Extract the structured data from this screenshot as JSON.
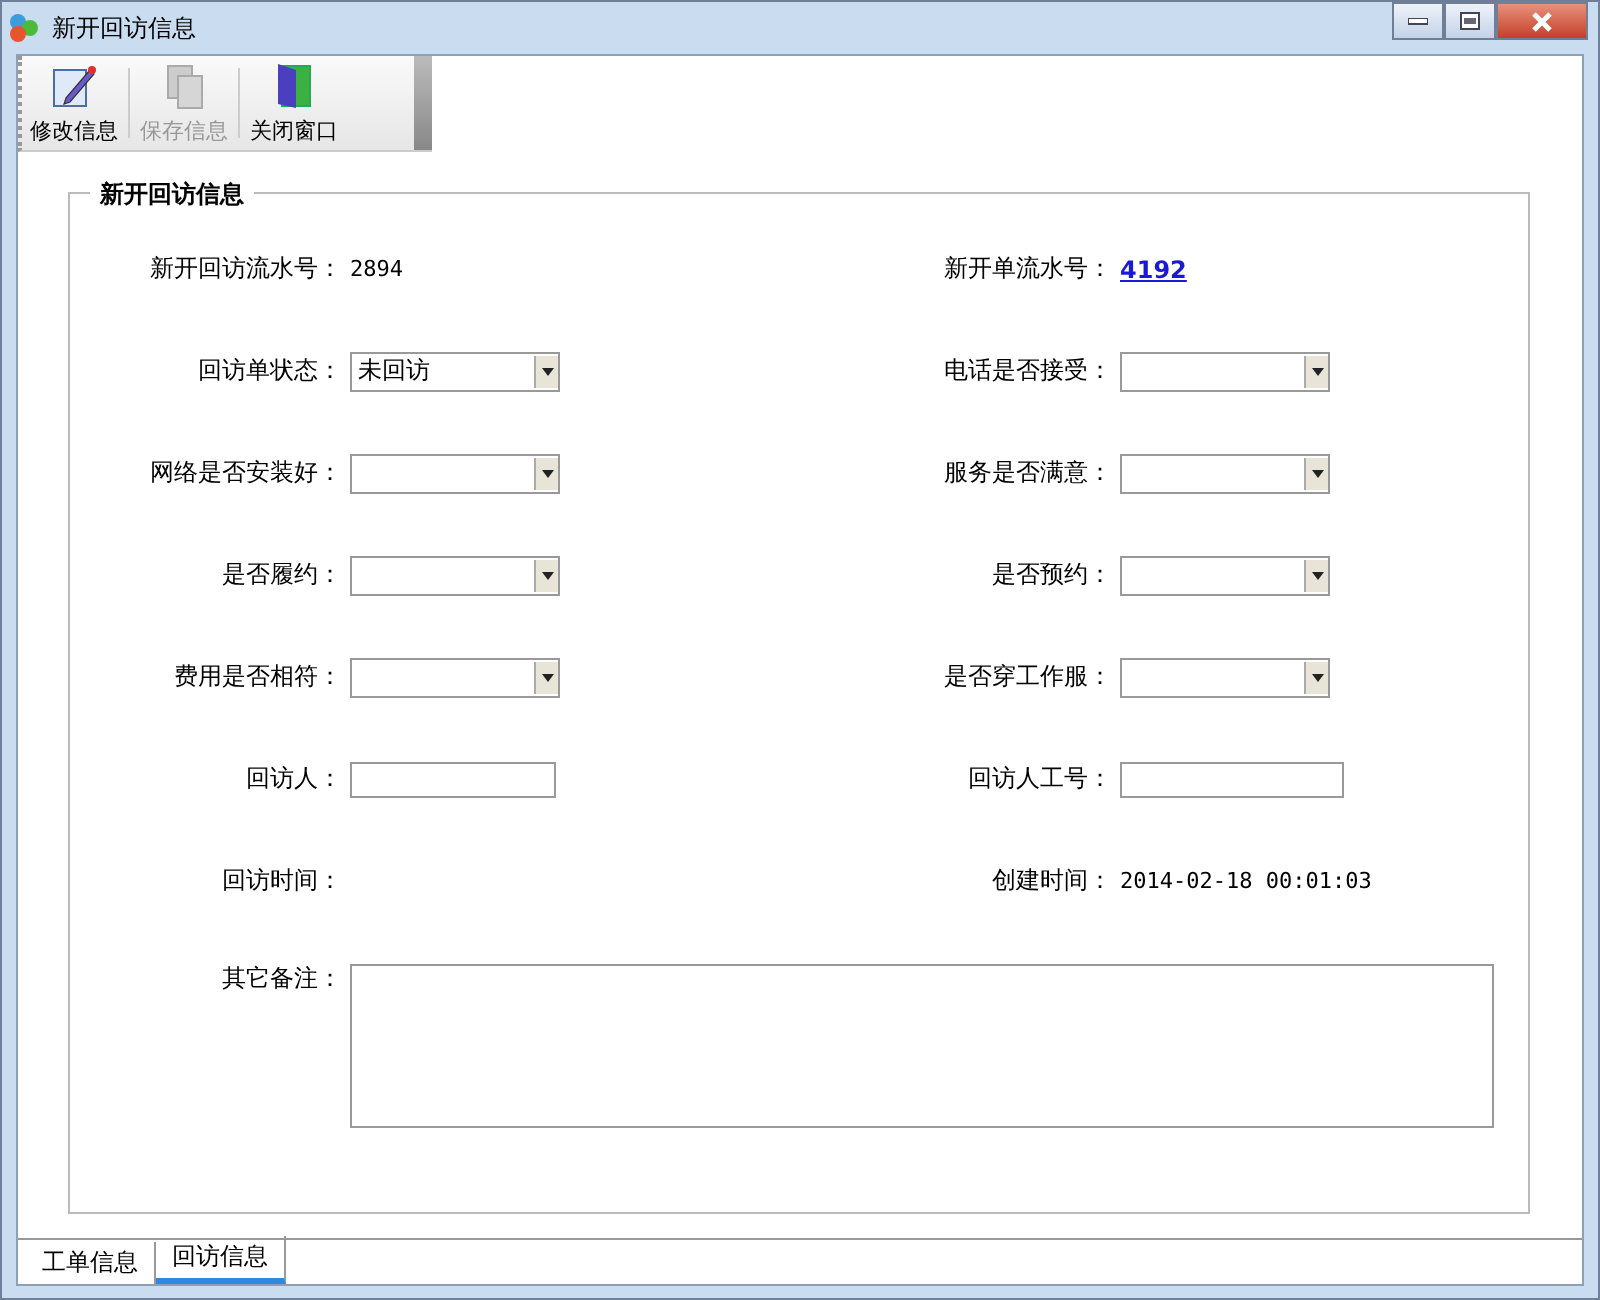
{
  "window": {
    "title": "新开回访信息"
  },
  "toolbar": [
    {
      "label": "修改信息",
      "kind": "edit",
      "disabled": false
    },
    {
      "label": "保存信息",
      "kind": "save",
      "disabled": true
    },
    {
      "label": "关闭窗口",
      "kind": "close",
      "disabled": false
    }
  ],
  "group": {
    "title": "新开回访信息"
  },
  "rows": [
    [
      {
        "label": "新开回访流水号：",
        "kind": "text",
        "value": "2894"
      },
      {
        "label": "新开单流水号：",
        "kind": "link",
        "value": "4192"
      }
    ],
    [
      {
        "label": "回访单状态：",
        "kind": "combo",
        "value": "未回访"
      },
      {
        "label": "电话是否接受：",
        "kind": "combo"
      }
    ],
    [
      {
        "label": "网络是否安装好：",
        "kind": "combo"
      },
      {
        "label": "服务是否满意：",
        "kind": "combo"
      }
    ],
    [
      {
        "label": "是否履约：",
        "kind": "combo"
      },
      {
        "label": "是否预约：",
        "kind": "combo"
      }
    ],
    [
      {
        "label": "费用是否相符：",
        "kind": "combo"
      },
      {
        "label": "是否穿工作服：",
        "kind": "combo"
      }
    ],
    [
      {
        "label": "回访人：",
        "kind": "input"
      },
      {
        "label": "回访人工号：",
        "kind": "input"
      }
    ],
    [
      {
        "label": "回访时间：",
        "kind": "text"
      },
      {
        "label": "创建时间：",
        "kind": "text",
        "value": "2014-02-18 00:01:03"
      }
    ]
  ],
  "remark": {
    "label": "其它备注："
  },
  "tabs": [
    {
      "label": "工单信息",
      "selected": false
    },
    {
      "label": "回访信息",
      "selected": true
    }
  ]
}
